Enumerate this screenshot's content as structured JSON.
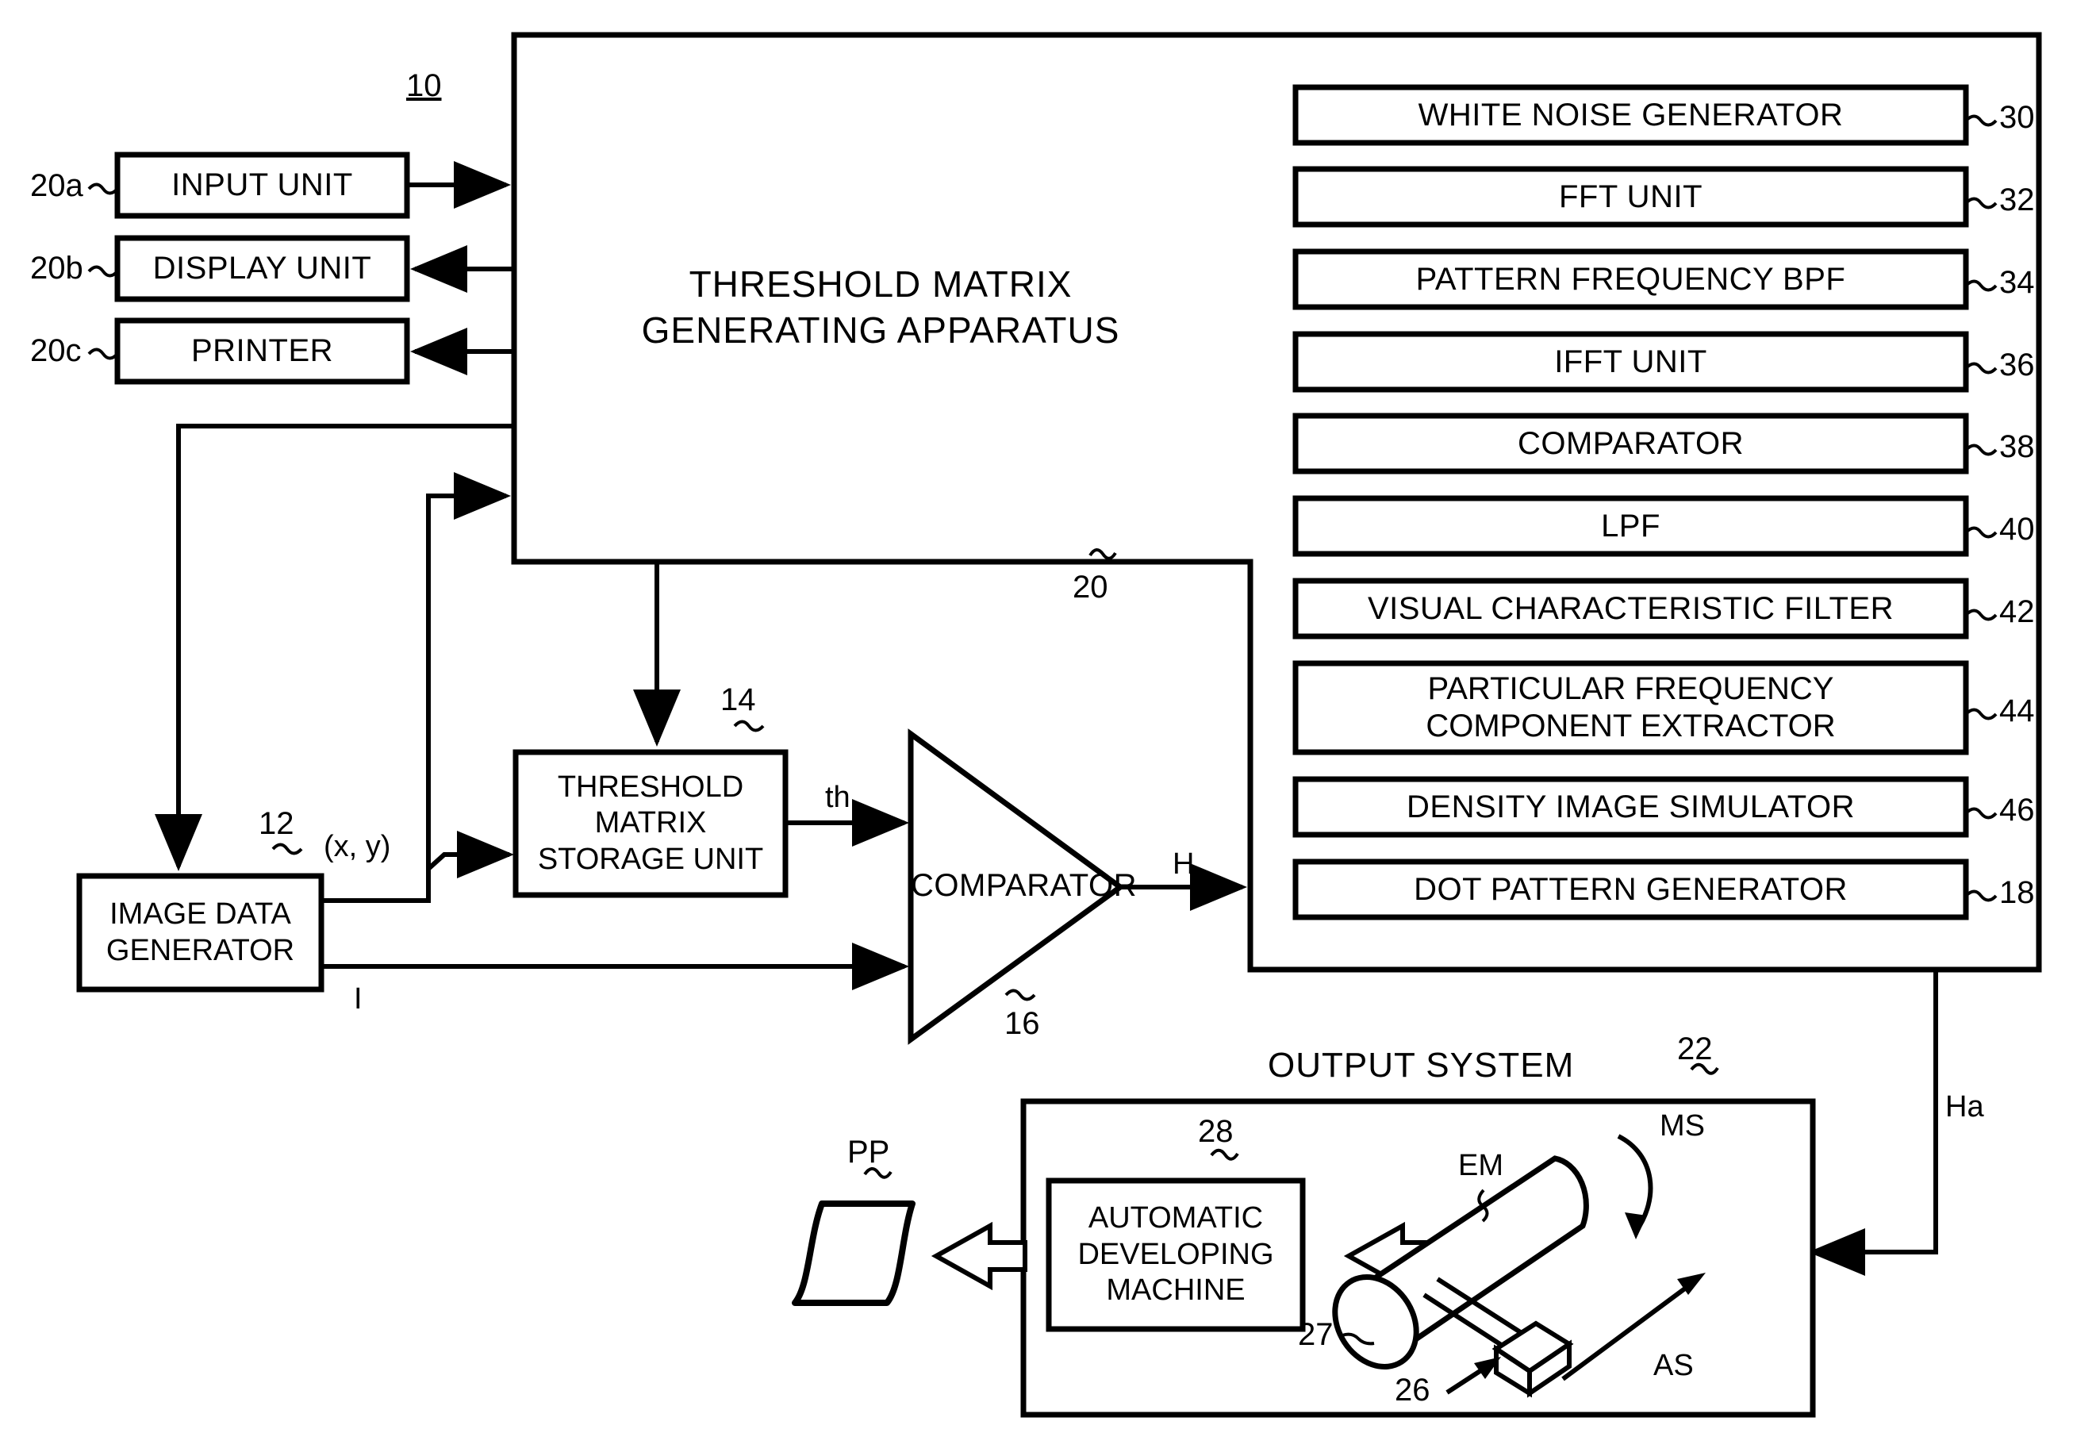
{
  "diagram": {
    "title_ref": "10",
    "main_apparatus": {
      "label": "THRESHOLD MATRIX\nGENERATING APPARATUS",
      "line1": "THRESHOLD MATRIX",
      "line2": "GENERATING APPARATUS",
      "ref": "20"
    },
    "peripherals": [
      {
        "ref": "20a",
        "label": "INPUT UNIT"
      },
      {
        "ref": "20b",
        "label": "DISPLAY UNIT"
      },
      {
        "ref": "20c",
        "label": "PRINTER"
      }
    ],
    "modules": [
      {
        "ref": "30",
        "label": "WHITE NOISE GENERATOR"
      },
      {
        "ref": "32",
        "label": "FFT UNIT"
      },
      {
        "ref": "34",
        "label": "PATTERN FREQUENCY BPF"
      },
      {
        "ref": "36",
        "label": "IFFT UNIT"
      },
      {
        "ref": "38",
        "label": "COMPARATOR"
      },
      {
        "ref": "40",
        "label": "LPF"
      },
      {
        "ref": "42",
        "label": "VISUAL CHARACTERISTIC FILTER"
      },
      {
        "ref": "44",
        "label": "PARTICULAR FREQUENCY\nCOMPONENT EXTRACTOR",
        "line1": "PARTICULAR FREQUENCY",
        "line2": "COMPONENT EXTRACTOR"
      },
      {
        "ref": "46",
        "label": "DENSITY IMAGE SIMULATOR"
      },
      {
        "ref": "18",
        "label": "DOT PATTERN GENERATOR"
      }
    ],
    "image_data_generator": {
      "ref": "12",
      "line1": "IMAGE DATA",
      "line2": "GENERATOR"
    },
    "threshold_storage": {
      "ref": "14",
      "line1": "THRESHOLD",
      "line2": "MATRIX",
      "line3": "STORAGE UNIT"
    },
    "comparator": {
      "ref": "16",
      "label": "COMPARATOR"
    },
    "signals": {
      "xy": "(x, y)",
      "th": "th",
      "i": "I",
      "h": "H",
      "ha": "Ha"
    },
    "output_system": {
      "title": "OUTPUT SYSTEM",
      "ref": "22",
      "developer": {
        "ref": "28",
        "line1": "AUTOMATIC",
        "line2": "DEVELOPING",
        "line3": "MACHINE"
      },
      "drum_ref": "27",
      "head_ref": "26",
      "labels": {
        "em": "EM",
        "ms": "MS",
        "as": "AS"
      }
    },
    "printing_plate": {
      "ref": "PP"
    },
    "colors": {
      "ink": "#000000",
      "paper": "#ffffff"
    }
  }
}
